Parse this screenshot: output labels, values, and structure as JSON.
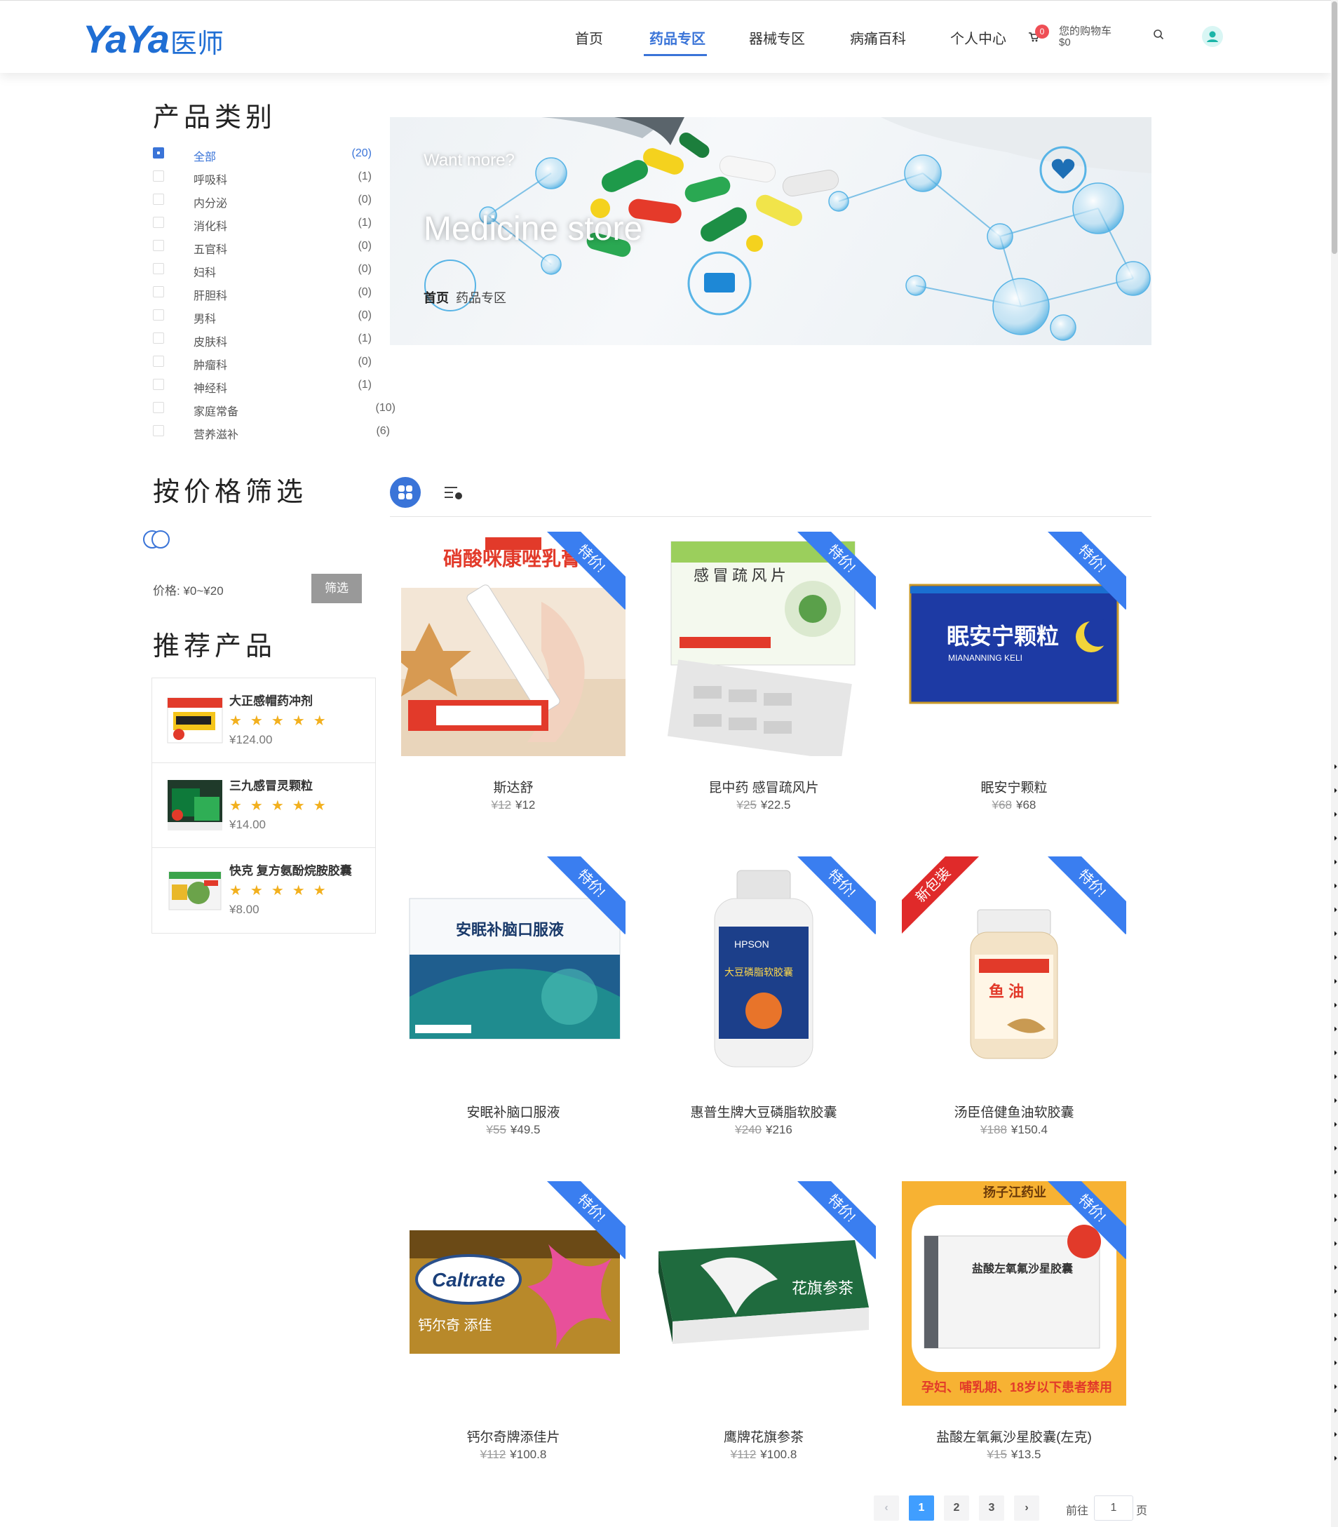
{
  "header": {
    "logo_latin": "YaYa",
    "logo_cn": "医师",
    "nav": [
      {
        "label": "首页"
      },
      {
        "label": "药品专区"
      },
      {
        "label": "器械专区"
      },
      {
        "label": "病痛百科"
      },
      {
        "label": "个人中心"
      }
    ],
    "active_nav": "药品专区",
    "cart": {
      "count": "0",
      "label": "您的购物车",
      "amount": "$0"
    },
    "icons": [
      "cart-icon",
      "search-icon",
      "user-icon"
    ],
    "accent_color": "#3a74d8"
  },
  "sidebar": {
    "category_title": "产品类别",
    "categories": [
      {
        "name": "全部",
        "count": "(20)",
        "checked": true
      },
      {
        "name": "呼吸科",
        "count": "(1)"
      },
      {
        "name": "内分泌",
        "count": "(0)"
      },
      {
        "name": "消化科",
        "count": "(1)"
      },
      {
        "name": "五官科",
        "count": "(0)"
      },
      {
        "name": "妇科",
        "count": "(0)"
      },
      {
        "name": "肝胆科",
        "count": "(0)"
      },
      {
        "name": "男科",
        "count": "(0)"
      },
      {
        "name": "皮肤科",
        "count": "(1)"
      },
      {
        "name": "肿瘤科",
        "count": "(0)"
      },
      {
        "name": "神经科",
        "count": "(1)"
      },
      {
        "name": "家庭常备",
        "count": "(10)"
      },
      {
        "name": "营养滋补",
        "count": "(6)"
      }
    ],
    "price_title": "按价格筛选",
    "price_label": "价格: ¥0~¥20",
    "filter_button": "筛选",
    "recommend_title": "推荐产品",
    "recommended": [
      {
        "name": "大正感帽药冲剂",
        "price": "¥124.00",
        "rating": "5"
      },
      {
        "name": "三九感冒灵颗粒",
        "price": "¥14.00",
        "rating": "5"
      },
      {
        "name": "快克 复方氨酚烷胺胶囊",
        "price": "¥8.00",
        "rating": "5"
      }
    ]
  },
  "banner": {
    "subtitle": "Want more?",
    "title": "Medicine store",
    "crumb_home": "首页",
    "crumb_current": "药品专区"
  },
  "products": [
    {
      "name": "斯达舒",
      "old_price": "¥12",
      "price": "¥12",
      "badge": "特价!"
    },
    {
      "name": "昆中药 感冒疏风片",
      "old_price": "¥25",
      "price": "¥22.5",
      "badge": "特价!"
    },
    {
      "name": "眠安宁颗粒",
      "old_price": "¥68",
      "price": "¥68",
      "badge": "特价!"
    },
    {
      "name": "安眠补脑口服液",
      "old_price": "¥55",
      "price": "¥49.5",
      "badge": "特价!"
    },
    {
      "name": "惠普生牌大豆磷脂软胶囊",
      "old_price": "¥240",
      "price": "¥216",
      "badge": "特价!"
    },
    {
      "name": "汤臣倍健鱼油软胶囊",
      "old_price": "¥188",
      "price": "¥150.4",
      "badge": "特价!",
      "badge2": "新包装"
    },
    {
      "name": "钙尔奇牌添佳片",
      "old_price": "¥112",
      "price": "¥100.8",
      "badge": "特价!"
    },
    {
      "name": "鹰牌花旗参茶",
      "old_price": "¥112",
      "price": "¥100.8",
      "badge": "特价!"
    },
    {
      "name": "盐酸左氧氟沙星胶囊(左克)",
      "old_price": "¥15",
      "price": "¥13.5",
      "badge": "特价!"
    }
  ],
  "pagination": {
    "prev": "‹",
    "pages": [
      "1",
      "2",
      "3"
    ],
    "current": "1",
    "next": "›",
    "goto_label": "前往",
    "goto_value": "1",
    "page_suffix": "页"
  }
}
